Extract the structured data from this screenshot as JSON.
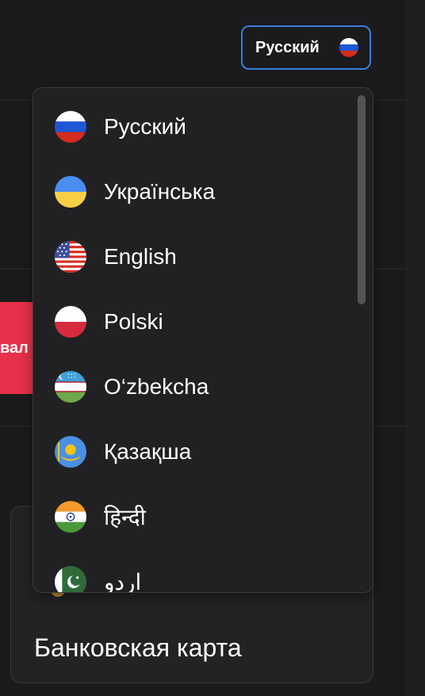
{
  "header": {
    "language_button": {
      "label": "Русский",
      "flag_icon": "russia-flag-icon"
    }
  },
  "background": {
    "red_button_partial_text": "вал",
    "bank_card": {
      "title": "Банковская карта"
    }
  },
  "language_menu": {
    "items": [
      {
        "label": "Русский",
        "flag_icon": "russia-flag-icon"
      },
      {
        "label": "Українська",
        "flag_icon": "ukraine-flag-icon"
      },
      {
        "label": "English",
        "flag_icon": "usa-flag-icon"
      },
      {
        "label": "Polski",
        "flag_icon": "poland-flag-icon"
      },
      {
        "label": "O‘zbekcha",
        "flag_icon": "uzbekistan-flag-icon"
      },
      {
        "label": "Қазақша",
        "flag_icon": "kazakhstan-flag-icon"
      },
      {
        "label": "हिन्दी",
        "flag_icon": "india-flag-icon"
      },
      {
        "label": "اردو",
        "flag_icon": "pakistan-flag-icon"
      }
    ]
  },
  "colors": {
    "background": "#1b1b1d",
    "menu_background": "#212123",
    "accent_border": "#3a7be0",
    "red_button": "#e9314b"
  }
}
